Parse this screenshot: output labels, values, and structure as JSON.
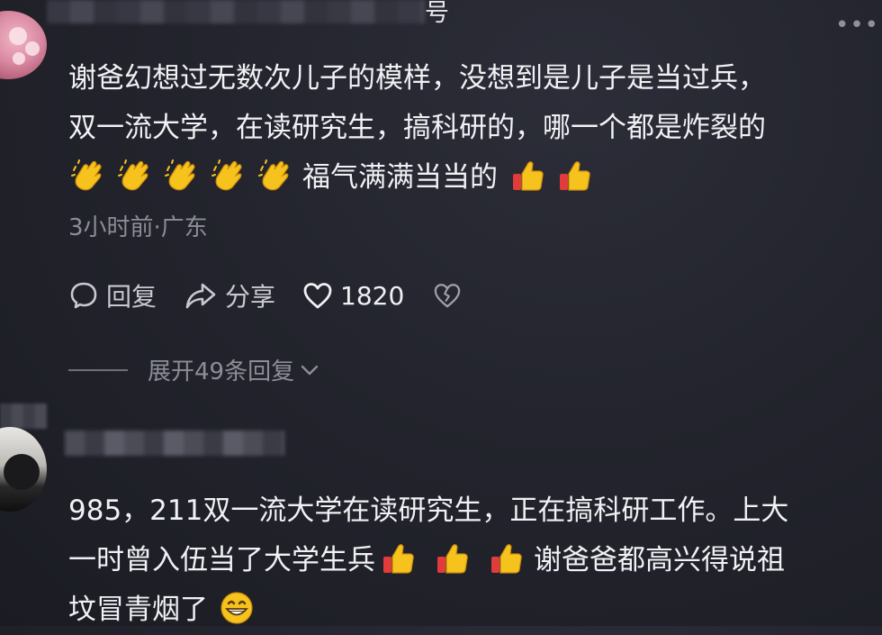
{
  "header": {
    "title_char": "号",
    "more_icon": "more-dots-icon"
  },
  "comment1": {
    "text_lines": [
      "谢爸幻想过无数次儿子的模样，没想到是儿子是当过兵，",
      "双一流大学，在读研究生，搞科研的，哪一个都是炸裂的"
    ],
    "line3_suffix": "福气满满当当的",
    "meta": "3小时前·广东",
    "actions": {
      "reply": "回复",
      "share": "分享",
      "likes": "1820"
    },
    "expand": "展开49条回复"
  },
  "comment2": {
    "line1": "985，211双一流大学在读研究生，正在搞科研工作。上大",
    "line2_prefix": "一时曾入伍当了大学生兵",
    "line2_suffix": "谢爸爸都高兴得说祖",
    "line3_prefix": "坟冒青烟了"
  },
  "icons": {
    "clap": "clapping-hands-icon",
    "thumb": "thumbs-up-icon",
    "grin": "grinning-face-icon",
    "reply": "comment-bubble-icon",
    "share": "share-arrow-icon",
    "like": "heart-icon",
    "dislike": "broken-heart-icon",
    "chevron": "chevron-down-icon"
  },
  "colors": {
    "background": "#23242d",
    "text": "#f1f1f5",
    "muted": "#8c8d97",
    "emoji_yellow": "#f6c21d",
    "emoji_red": "#e23b3b"
  }
}
